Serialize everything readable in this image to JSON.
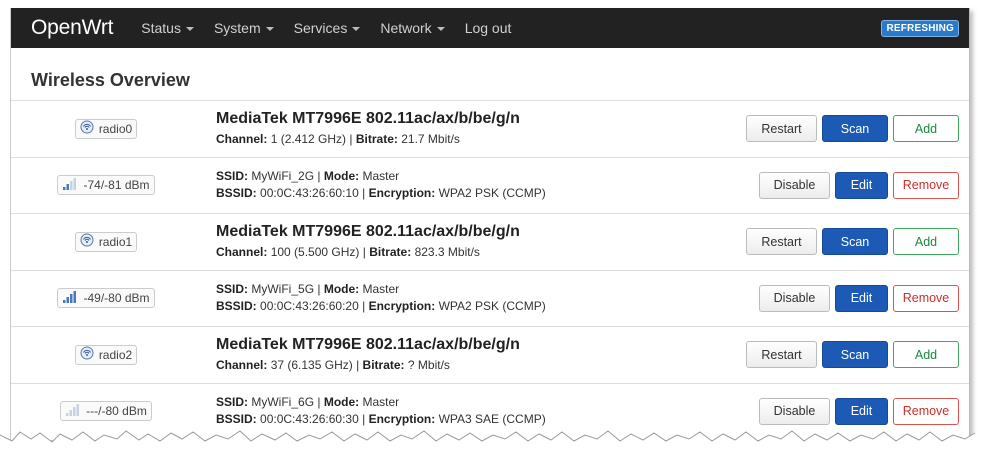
{
  "navbar": {
    "brand": "OpenWrt",
    "menu": [
      {
        "label": "Status",
        "dropdown": true
      },
      {
        "label": "System",
        "dropdown": true
      },
      {
        "label": "Services",
        "dropdown": true
      },
      {
        "label": "Network",
        "dropdown": true
      },
      {
        "label": "Log out",
        "dropdown": false
      }
    ],
    "refresh_badge": "REFRESHING"
  },
  "page": {
    "title": "Wireless Overview"
  },
  "rows": [
    {
      "kind": "radio",
      "badge": "radio0",
      "icon": "wifi-radio-icon",
      "title": "MediaTek MT7996E 802.11ac/ax/b/be/g/n",
      "line1_label1": "Channel:",
      "line1_value1": "1 (2.412 GHz)",
      "line1_label2": "Bitrate:",
      "line1_value2": "21.7 Mbit/s",
      "buttons": [
        "Restart",
        "Scan",
        "Add"
      ]
    },
    {
      "kind": "net",
      "badge": "-74/-81 dBm",
      "icon": "signal-bars-icon",
      "signal_level": 0.5,
      "line1_label1": "SSID:",
      "line1_value1": "MyWiFi_2G",
      "line1_label2": "Mode:",
      "line1_value2": "Master",
      "line2_label1": "BSSID:",
      "line2_value1": "00:0C:43:26:60:10",
      "line2_label2": "Encryption:",
      "line2_value2": "WPA2 PSK (CCMP)",
      "buttons": [
        "Disable",
        "Edit",
        "Remove"
      ]
    },
    {
      "kind": "radio",
      "badge": "radio1",
      "icon": "wifi-radio-icon",
      "title": "MediaTek MT7996E 802.11ac/ax/b/be/g/n",
      "line1_label1": "Channel:",
      "line1_value1": "100 (5.500 GHz)",
      "line1_label2": "Bitrate:",
      "line1_value2": "823.3 Mbit/s",
      "buttons": [
        "Restart",
        "Scan",
        "Add"
      ]
    },
    {
      "kind": "net",
      "badge": "-49/-80 dBm",
      "icon": "signal-bars-icon",
      "signal_level": 1.0,
      "line1_label1": "SSID:",
      "line1_value1": "MyWiFi_5G",
      "line1_label2": "Mode:",
      "line1_value2": "Master",
      "line2_label1": "BSSID:",
      "line2_value1": "00:0C:43:26:60:20",
      "line2_label2": "Encryption:",
      "line2_value2": "WPA2 PSK (CCMP)",
      "buttons": [
        "Disable",
        "Edit",
        "Remove"
      ]
    },
    {
      "kind": "radio",
      "badge": "radio2",
      "icon": "wifi-radio-icon",
      "title": "MediaTek MT7996E 802.11ac/ax/b/be/g/n",
      "line1_label1": "Channel:",
      "line1_value1": "37 (6.135 GHz)",
      "line1_label2": "Bitrate:",
      "line1_value2": "? Mbit/s",
      "buttons": [
        "Restart",
        "Scan",
        "Add"
      ]
    },
    {
      "kind": "net",
      "badge": "---/-80 dBm",
      "icon": "signal-bars-icon",
      "signal_level": 0.0,
      "line1_label1": "SSID:",
      "line1_value1": "MyWiFi_6G",
      "line1_label2": "Mode:",
      "line1_value2": "Master",
      "line2_label1": "BSSID:",
      "line2_value1": "00:0C:43:26:60:30",
      "line2_label2": "Encryption:",
      "line2_value2": "WPA3 SAE (CCMP)",
      "buttons": [
        "Disable",
        "Edit",
        "Remove"
      ]
    }
  ],
  "colors": {
    "navbar_bg": "#222222",
    "primary": "#1d5ab5",
    "add": "#3ea85c",
    "remove": "#d9534f",
    "badge": "#2b7ac9"
  }
}
